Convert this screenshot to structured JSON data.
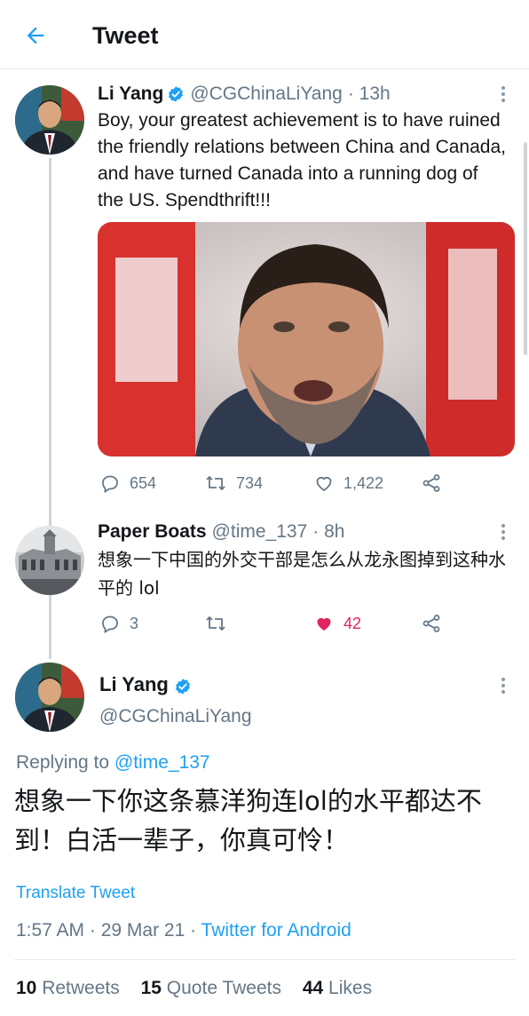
{
  "header": {
    "title": "Tweet"
  },
  "tweet1": {
    "name": "Li Yang",
    "handle": "@CGChinaLiYang",
    "time": "· 13h",
    "text": "Boy, your greatest achievement is to  have ruined the friendly relations between China and Canada, and have turned Canada into a running dog of the US. Spendthrift!!!",
    "replies": "654",
    "retweets": "734",
    "likes": "1,422"
  },
  "tweet2": {
    "name": "Paper Boats",
    "handle": "@time_137",
    "time": "· 8h",
    "text": "想象一下中国的外交干部是怎么从龙永图掉到这种水平的 lol",
    "replies": "3",
    "retweets": "",
    "likes": "42"
  },
  "main_tweet": {
    "name": "Li Yang",
    "handle": "@CGChinaLiYang",
    "replying_prefix": "Replying to",
    "replying_to": "@time_137",
    "text": "想象一下你这条慕洋狗连lol的水平都达不到！白活一辈子，你真可怜！",
    "translate": "Translate Tweet",
    "timestamp": "1:57 AM · 29 Mar 21 · ",
    "client": "Twitter for Android",
    "retweets_count": "10",
    "retweets_label": "Retweets",
    "quotes_count": "15",
    "quotes_label": "Quote Tweets",
    "likes_count": "44",
    "likes_label": "Likes"
  },
  "colors": {
    "accent": "#1da1f2",
    "like_red": "#e0245e",
    "secondary_text": "#657786"
  }
}
